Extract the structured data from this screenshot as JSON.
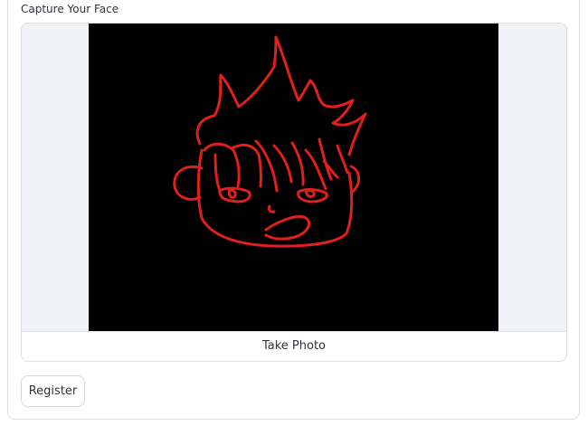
{
  "camera_input": {
    "label": "Capture Your Face",
    "take_photo_label": "Take Photo",
    "preview": {
      "content": "red-doodle-face-drawing",
      "background_color": "#000000",
      "stroke_color": "#e0201b"
    }
  },
  "form": {
    "submit_label": "Register"
  },
  "colors": {
    "text": "#31333f",
    "border": "#dcdde3",
    "letterbox": "#f0f2f6"
  }
}
